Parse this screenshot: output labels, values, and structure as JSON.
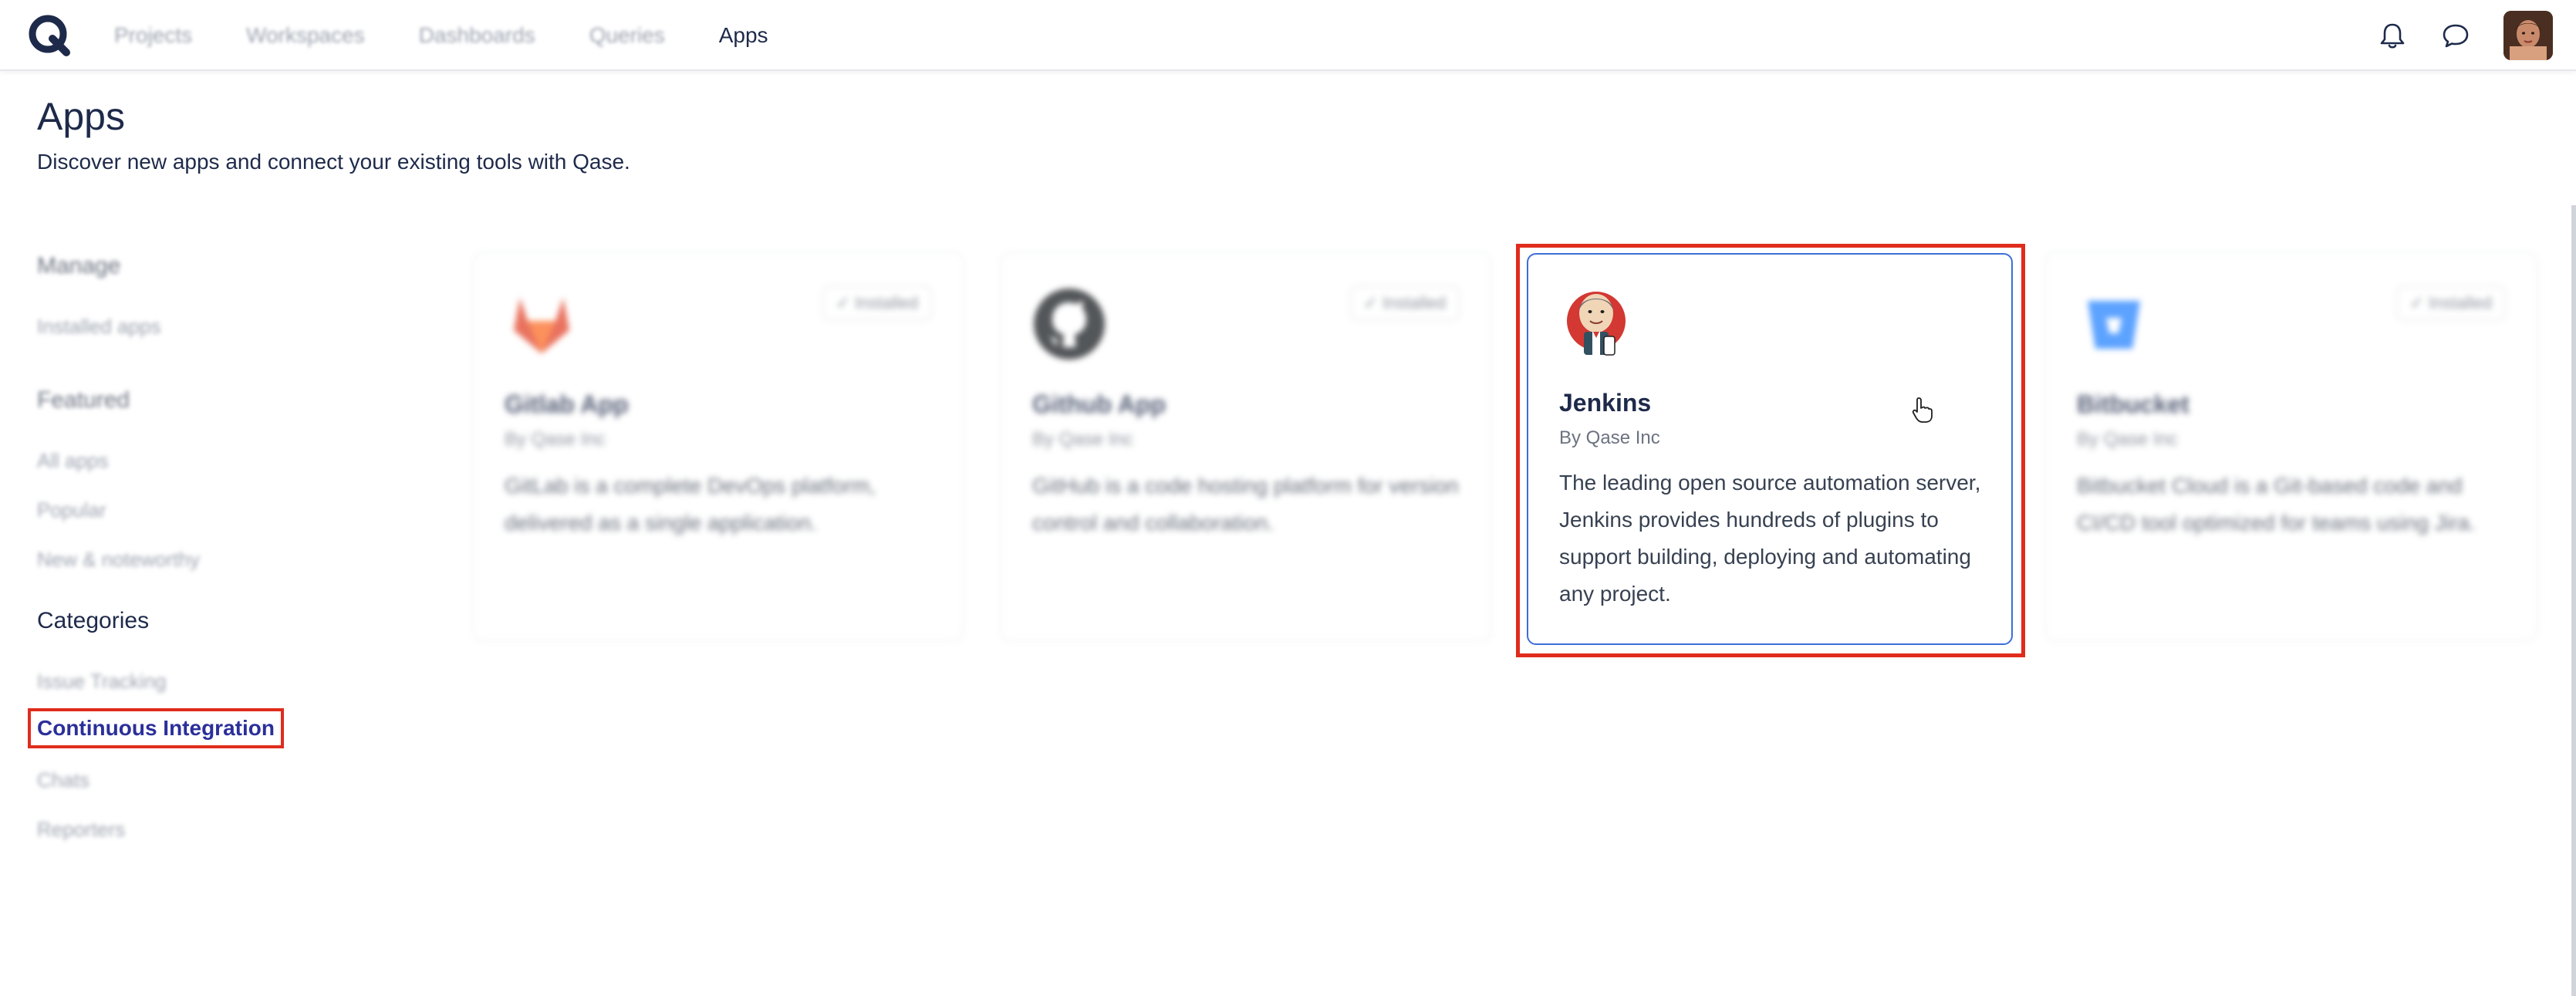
{
  "nav": {
    "items": [
      "Projects",
      "Workspaces",
      "Dashboards",
      "Queries",
      "Apps"
    ],
    "active": "Apps"
  },
  "top_icons": [
    "bell-icon",
    "chat-icon",
    "user-avatar"
  ],
  "page": {
    "title": "Apps",
    "subtitle": "Discover new apps and connect your existing tools with Qase."
  },
  "sidebar": {
    "manage_heading": "Manage",
    "manage_links": [
      "Installed apps"
    ],
    "featured_heading": "Featured",
    "featured_links": [
      "All apps",
      "Popular",
      "New & noteworthy"
    ],
    "categories_heading": "Categories",
    "category_links": [
      "Issue Tracking",
      "Continuous Integration",
      "Chats",
      "Reporters"
    ],
    "active_category": "Continuous Integration"
  },
  "cards": [
    {
      "name": "Gitlab App",
      "by": "By Qase Inc",
      "desc": "GitLab is a complete DevOps platform, delivered as a single application.",
      "badge": "✓ Installed",
      "icon": "gitlab-icon"
    },
    {
      "name": "Github App",
      "by": "By Qase Inc",
      "desc": "GitHub is a code hosting platform for version control and collaboration.",
      "badge": "✓ Installed",
      "icon": "github-icon"
    },
    {
      "name": "Jenkins",
      "by": "By Qase Inc",
      "desc": "The leading open source automation server, Jenkins provides hundreds of plugins to support building, deploying and automating any project.",
      "badge": "",
      "icon": "jenkins-icon"
    },
    {
      "name": "Bitbucket",
      "by": "By Qase Inc",
      "desc": "Bitbucket Cloud is a Git-based code and CI/CD tool optimized for teams using Jira.",
      "badge": "✓ Installed",
      "icon": "bitbucket-icon"
    }
  ],
  "colors": {
    "highlight": "#e02c1c",
    "brand_dark": "#1e2a4a",
    "active_link": "#2b2f9a",
    "card_selected_border": "#3b6fd8"
  }
}
